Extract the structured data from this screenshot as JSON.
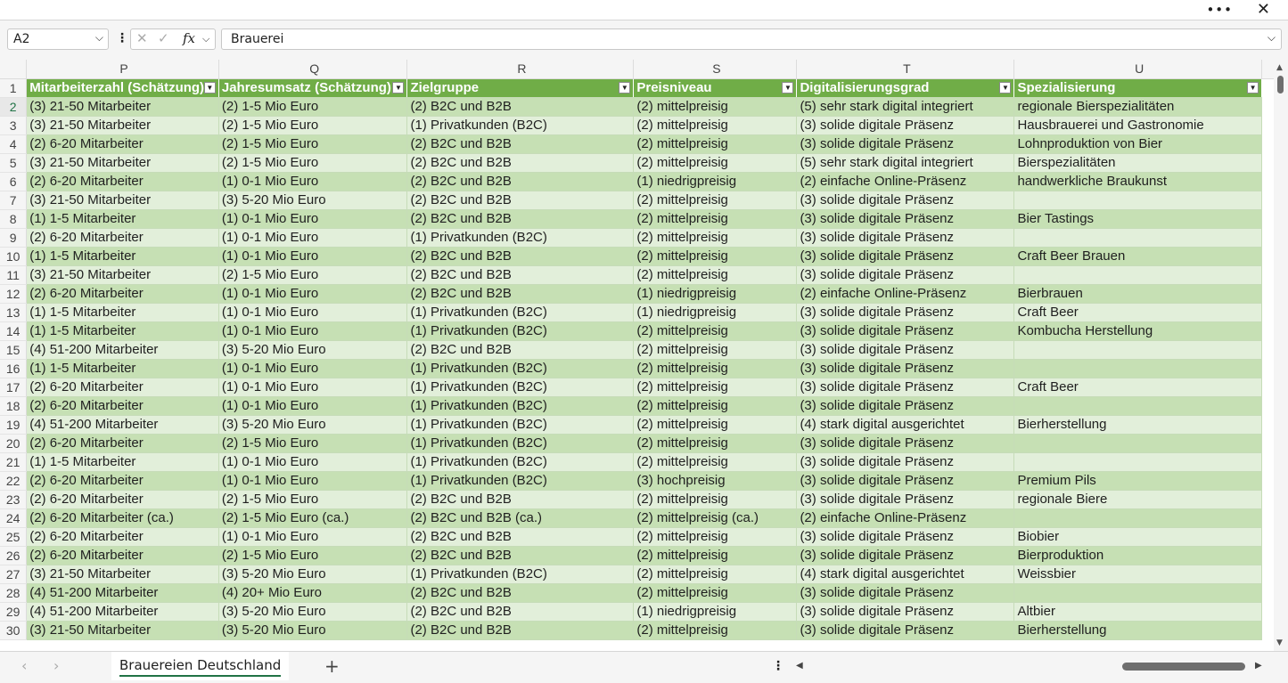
{
  "window": {
    "more_icon": "more-horizontal-icon",
    "close_icon": "close-icon"
  },
  "formula_bar": {
    "name_box": "A2",
    "formula": "Brauerei"
  },
  "columns": [
    "P",
    "Q",
    "R",
    "S",
    "T",
    "U"
  ],
  "headers": [
    "Mitarbeiterzahl (Schätzung)",
    "Jahresumsatz (Schätzung)",
    "Zielgruppe",
    "Preisniveau",
    "Digitalisierungsgrad",
    "Spezialisierung"
  ],
  "rows": [
    [
      "2",
      "(3) 21-50 Mitarbeiter",
      "(2) 1-5 Mio Euro",
      "(2) B2C und B2B",
      "(2) mittelpreisig",
      "(5) sehr stark digital integriert",
      "regionale Bierspezialitäten"
    ],
    [
      "3",
      "(3) 21-50 Mitarbeiter",
      "(2) 1-5 Mio Euro",
      "(1) Privatkunden (B2C)",
      "(2) mittelpreisig",
      "(3) solide digitale Präsenz",
      "Hausbrauerei und Gastronomie"
    ],
    [
      "4",
      "(2) 6-20 Mitarbeiter",
      "(2) 1-5 Mio Euro",
      "(2) B2C und B2B",
      "(2) mittelpreisig",
      "(3) solide digitale Präsenz",
      "Lohnproduktion von Bier"
    ],
    [
      "5",
      "(3) 21-50 Mitarbeiter",
      "(2) 1-5 Mio Euro",
      "(2) B2C und B2B",
      "(2) mittelpreisig",
      "(5) sehr stark digital integriert",
      "Bierspezialitäten"
    ],
    [
      "6",
      "(2) 6-20 Mitarbeiter",
      "(1) 0-1 Mio Euro",
      "(2) B2C und B2B",
      "(1) niedrigpreisig",
      "(2) einfache Online-Präsenz",
      "handwerkliche Braukunst"
    ],
    [
      "7",
      "(3) 21-50 Mitarbeiter",
      "(3) 5-20 Mio Euro",
      "(2) B2C und B2B",
      "(2) mittelpreisig",
      "(3) solide digitale Präsenz",
      ""
    ],
    [
      "8",
      "(1) 1-5 Mitarbeiter",
      "(1) 0-1 Mio Euro",
      "(2) B2C und B2B",
      "(2) mittelpreisig",
      "(3) solide digitale Präsenz",
      "Bier Tastings"
    ],
    [
      "9",
      "(2) 6-20 Mitarbeiter",
      "(1) 0-1 Mio Euro",
      "(1) Privatkunden (B2C)",
      "(2) mittelpreisig",
      "(3) solide digitale Präsenz",
      ""
    ],
    [
      "10",
      "(1) 1-5 Mitarbeiter",
      "(1) 0-1 Mio Euro",
      "(2) B2C und B2B",
      "(2) mittelpreisig",
      "(3) solide digitale Präsenz",
      "Craft Beer Brauen"
    ],
    [
      "11",
      "(3) 21-50 Mitarbeiter",
      "(2) 1-5 Mio Euro",
      "(2) B2C und B2B",
      "(2) mittelpreisig",
      "(3) solide digitale Präsenz",
      ""
    ],
    [
      "12",
      "(2) 6-20 Mitarbeiter",
      "(1) 0-1 Mio Euro",
      "(2) B2C und B2B",
      "(1) niedrigpreisig",
      "(2) einfache Online-Präsenz",
      "Bierbrauen"
    ],
    [
      "13",
      "(1) 1-5 Mitarbeiter",
      "(1) 0-1 Mio Euro",
      "(1) Privatkunden (B2C)",
      "(1) niedrigpreisig",
      "(3) solide digitale Präsenz",
      "Craft Beer"
    ],
    [
      "14",
      "(1) 1-5 Mitarbeiter",
      "(1) 0-1 Mio Euro",
      "(1) Privatkunden (B2C)",
      "(2) mittelpreisig",
      "(3) solide digitale Präsenz",
      "Kombucha Herstellung"
    ],
    [
      "15",
      "(4) 51-200 Mitarbeiter",
      "(3) 5-20 Mio Euro",
      "(2) B2C und B2B",
      "(2) mittelpreisig",
      "(3) solide digitale Präsenz",
      ""
    ],
    [
      "16",
      "(1) 1-5 Mitarbeiter",
      "(1) 0-1 Mio Euro",
      "(1) Privatkunden (B2C)",
      "(2) mittelpreisig",
      "(3) solide digitale Präsenz",
      ""
    ],
    [
      "17",
      "(2) 6-20 Mitarbeiter",
      "(1) 0-1 Mio Euro",
      "(1) Privatkunden (B2C)",
      "(2) mittelpreisig",
      "(3) solide digitale Präsenz",
      "Craft Beer"
    ],
    [
      "18",
      "(2) 6-20 Mitarbeiter",
      "(1) 0-1 Mio Euro",
      "(1) Privatkunden (B2C)",
      "(2) mittelpreisig",
      "(3) solide digitale Präsenz",
      ""
    ],
    [
      "19",
      "(4) 51-200 Mitarbeiter",
      "(3) 5-20 Mio Euro",
      "(1) Privatkunden (B2C)",
      "(2) mittelpreisig",
      "(4) stark digital ausgerichtet",
      "Bierherstellung"
    ],
    [
      "20",
      "(2) 6-20 Mitarbeiter",
      "(2) 1-5 Mio Euro",
      "(1) Privatkunden (B2C)",
      "(2) mittelpreisig",
      "(3) solide digitale Präsenz",
      ""
    ],
    [
      "21",
      "(1) 1-5 Mitarbeiter",
      "(1) 0-1 Mio Euro",
      "(1) Privatkunden (B2C)",
      "(2) mittelpreisig",
      "(3) solide digitale Präsenz",
      ""
    ],
    [
      "22",
      "(2) 6-20 Mitarbeiter",
      "(1) 0-1 Mio Euro",
      "(1) Privatkunden (B2C)",
      "(3) hochpreisig",
      "(3) solide digitale Präsenz",
      "Premium Pils"
    ],
    [
      "23",
      "(2) 6-20 Mitarbeiter",
      "(2) 1-5 Mio Euro",
      "(2) B2C und B2B",
      "(2) mittelpreisig",
      "(3) solide digitale Präsenz",
      "regionale Biere"
    ],
    [
      "24",
      "(2) 6-20 Mitarbeiter (ca.)",
      "(2) 1-5 Mio Euro (ca.)",
      "(2) B2C und B2B (ca.)",
      "(2) mittelpreisig (ca.)",
      "(2) einfache Online-Präsenz",
      ""
    ],
    [
      "25",
      "(2) 6-20 Mitarbeiter",
      "(1) 0-1 Mio Euro",
      "(2) B2C und B2B",
      "(2) mittelpreisig",
      "(3) solide digitale Präsenz",
      "Biobier"
    ],
    [
      "26",
      "(2) 6-20 Mitarbeiter",
      "(2) 1-5 Mio Euro",
      "(2) B2C und B2B",
      "(2) mittelpreisig",
      "(3) solide digitale Präsenz",
      "Bierproduktion"
    ],
    [
      "27",
      "(3) 21-50 Mitarbeiter",
      "(3) 5-20 Mio Euro",
      "(1) Privatkunden (B2C)",
      "(2) mittelpreisig",
      "(4) stark digital ausgerichtet",
      "Weissbier"
    ],
    [
      "28",
      "(4) 51-200 Mitarbeiter",
      "(4) 20+ Mio Euro",
      "(2) B2C und B2B",
      "(2) mittelpreisig",
      "(3) solide digitale Präsenz",
      ""
    ],
    [
      "29",
      "(4) 51-200 Mitarbeiter",
      "(3) 5-20 Mio Euro",
      "(2) B2C und B2B",
      "(1) niedrigpreisig",
      "(3) solide digitale Präsenz",
      "Altbier"
    ],
    [
      "30",
      "(3) 21-50 Mitarbeiter",
      "(3) 5-20 Mio Euro",
      "(2) B2C und B2B",
      "(2) mittelpreisig",
      "(3) solide digitale Präsenz",
      "Bierherstellung"
    ]
  ],
  "sheet_tab": "Brauereien Deutschland",
  "colors": {
    "header_green": "#70ad47",
    "band_dark": "#c6e0b4",
    "band_light": "#e2efda",
    "accent": "#217346"
  }
}
